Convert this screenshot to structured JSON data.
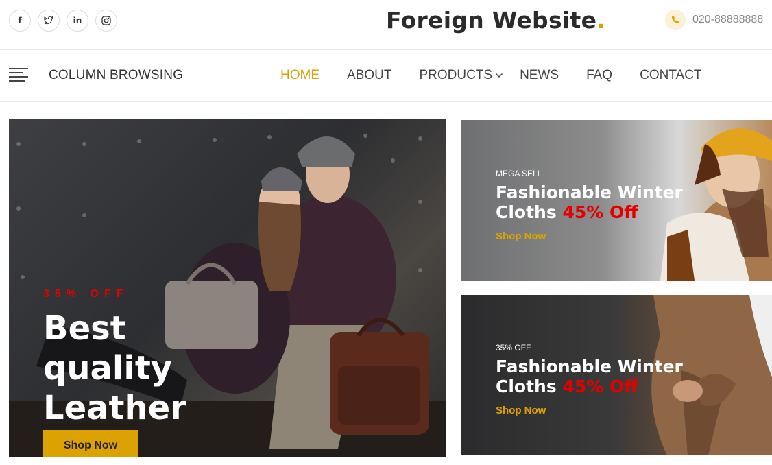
{
  "header": {
    "socials": [
      {
        "icon": "facebook-icon",
        "glyph": "f"
      },
      {
        "icon": "twitter-icon",
        "glyph": ""
      },
      {
        "icon": "linkedin-icon",
        "glyph": "in"
      },
      {
        "icon": "instagram-icon",
        "glyph": ""
      }
    ],
    "brand": "Foreign Website",
    "brand_dot": ".",
    "phone": "020-88888888"
  },
  "nav": {
    "column_browsing": "COLUMN BROWSING",
    "items": [
      "HOME",
      "ABOUT",
      "PRODUCTS",
      "NEWS",
      "FAQ",
      "CONTACT"
    ],
    "active": "HOME"
  },
  "hero": {
    "offer": "35% OFF",
    "headline_line1": "Best",
    "headline_line2": "quality",
    "headline_line3": "Leather",
    "cta": "Shop Now"
  },
  "promos": [
    {
      "label": "MEGA SELL",
      "title_line1": "Fashionable Winter",
      "title_line2": "Cloths",
      "discount": "45% Off",
      "cta": "Shop Now"
    },
    {
      "label": "35% OFF",
      "title_line1": "Fashionable Winter",
      "title_line2": "Cloths",
      "discount": "45% Off",
      "cta": "Shop Now"
    }
  ],
  "colors": {
    "accent": "#dca202",
    "sale": "#e50000",
    "text": "#333333"
  }
}
